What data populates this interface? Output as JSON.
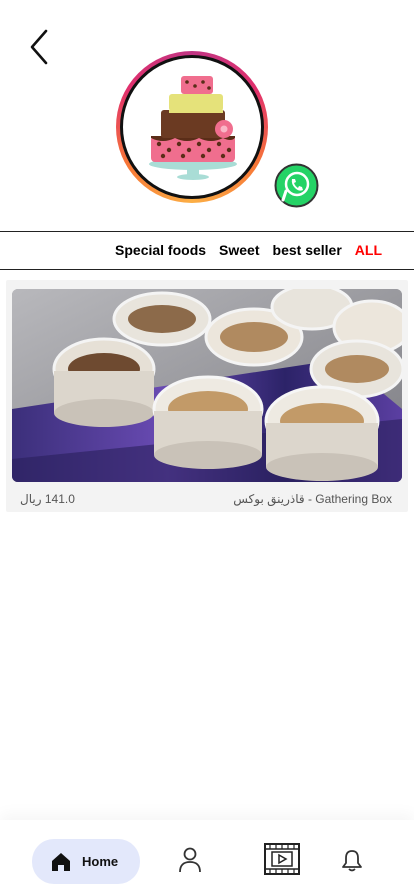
{
  "header": {
    "back_icon": "chevron-left-icon",
    "logo": "cake-logo",
    "whatsapp_icon": "whatsapp-icon"
  },
  "categories": [
    {
      "label": "Special foods",
      "active": false
    },
    {
      "label": "Sweet",
      "active": false
    },
    {
      "label": "best seller",
      "active": false
    },
    {
      "label": "ALL",
      "active": true
    }
  ],
  "colors": {
    "active_category": "#ff0000",
    "whatsapp": "#25d366",
    "nav_active_bg": "#e3e8fb"
  },
  "products": [
    {
      "name": "قاذرينق بوكس - Gathering Box",
      "price": "141.0 ريال",
      "image": "dessert-cups-photo"
    }
  ],
  "bottom_nav": {
    "home_label": "Home",
    "items": [
      "home-icon",
      "user-icon",
      "video-icon",
      "bell-icon"
    ]
  }
}
